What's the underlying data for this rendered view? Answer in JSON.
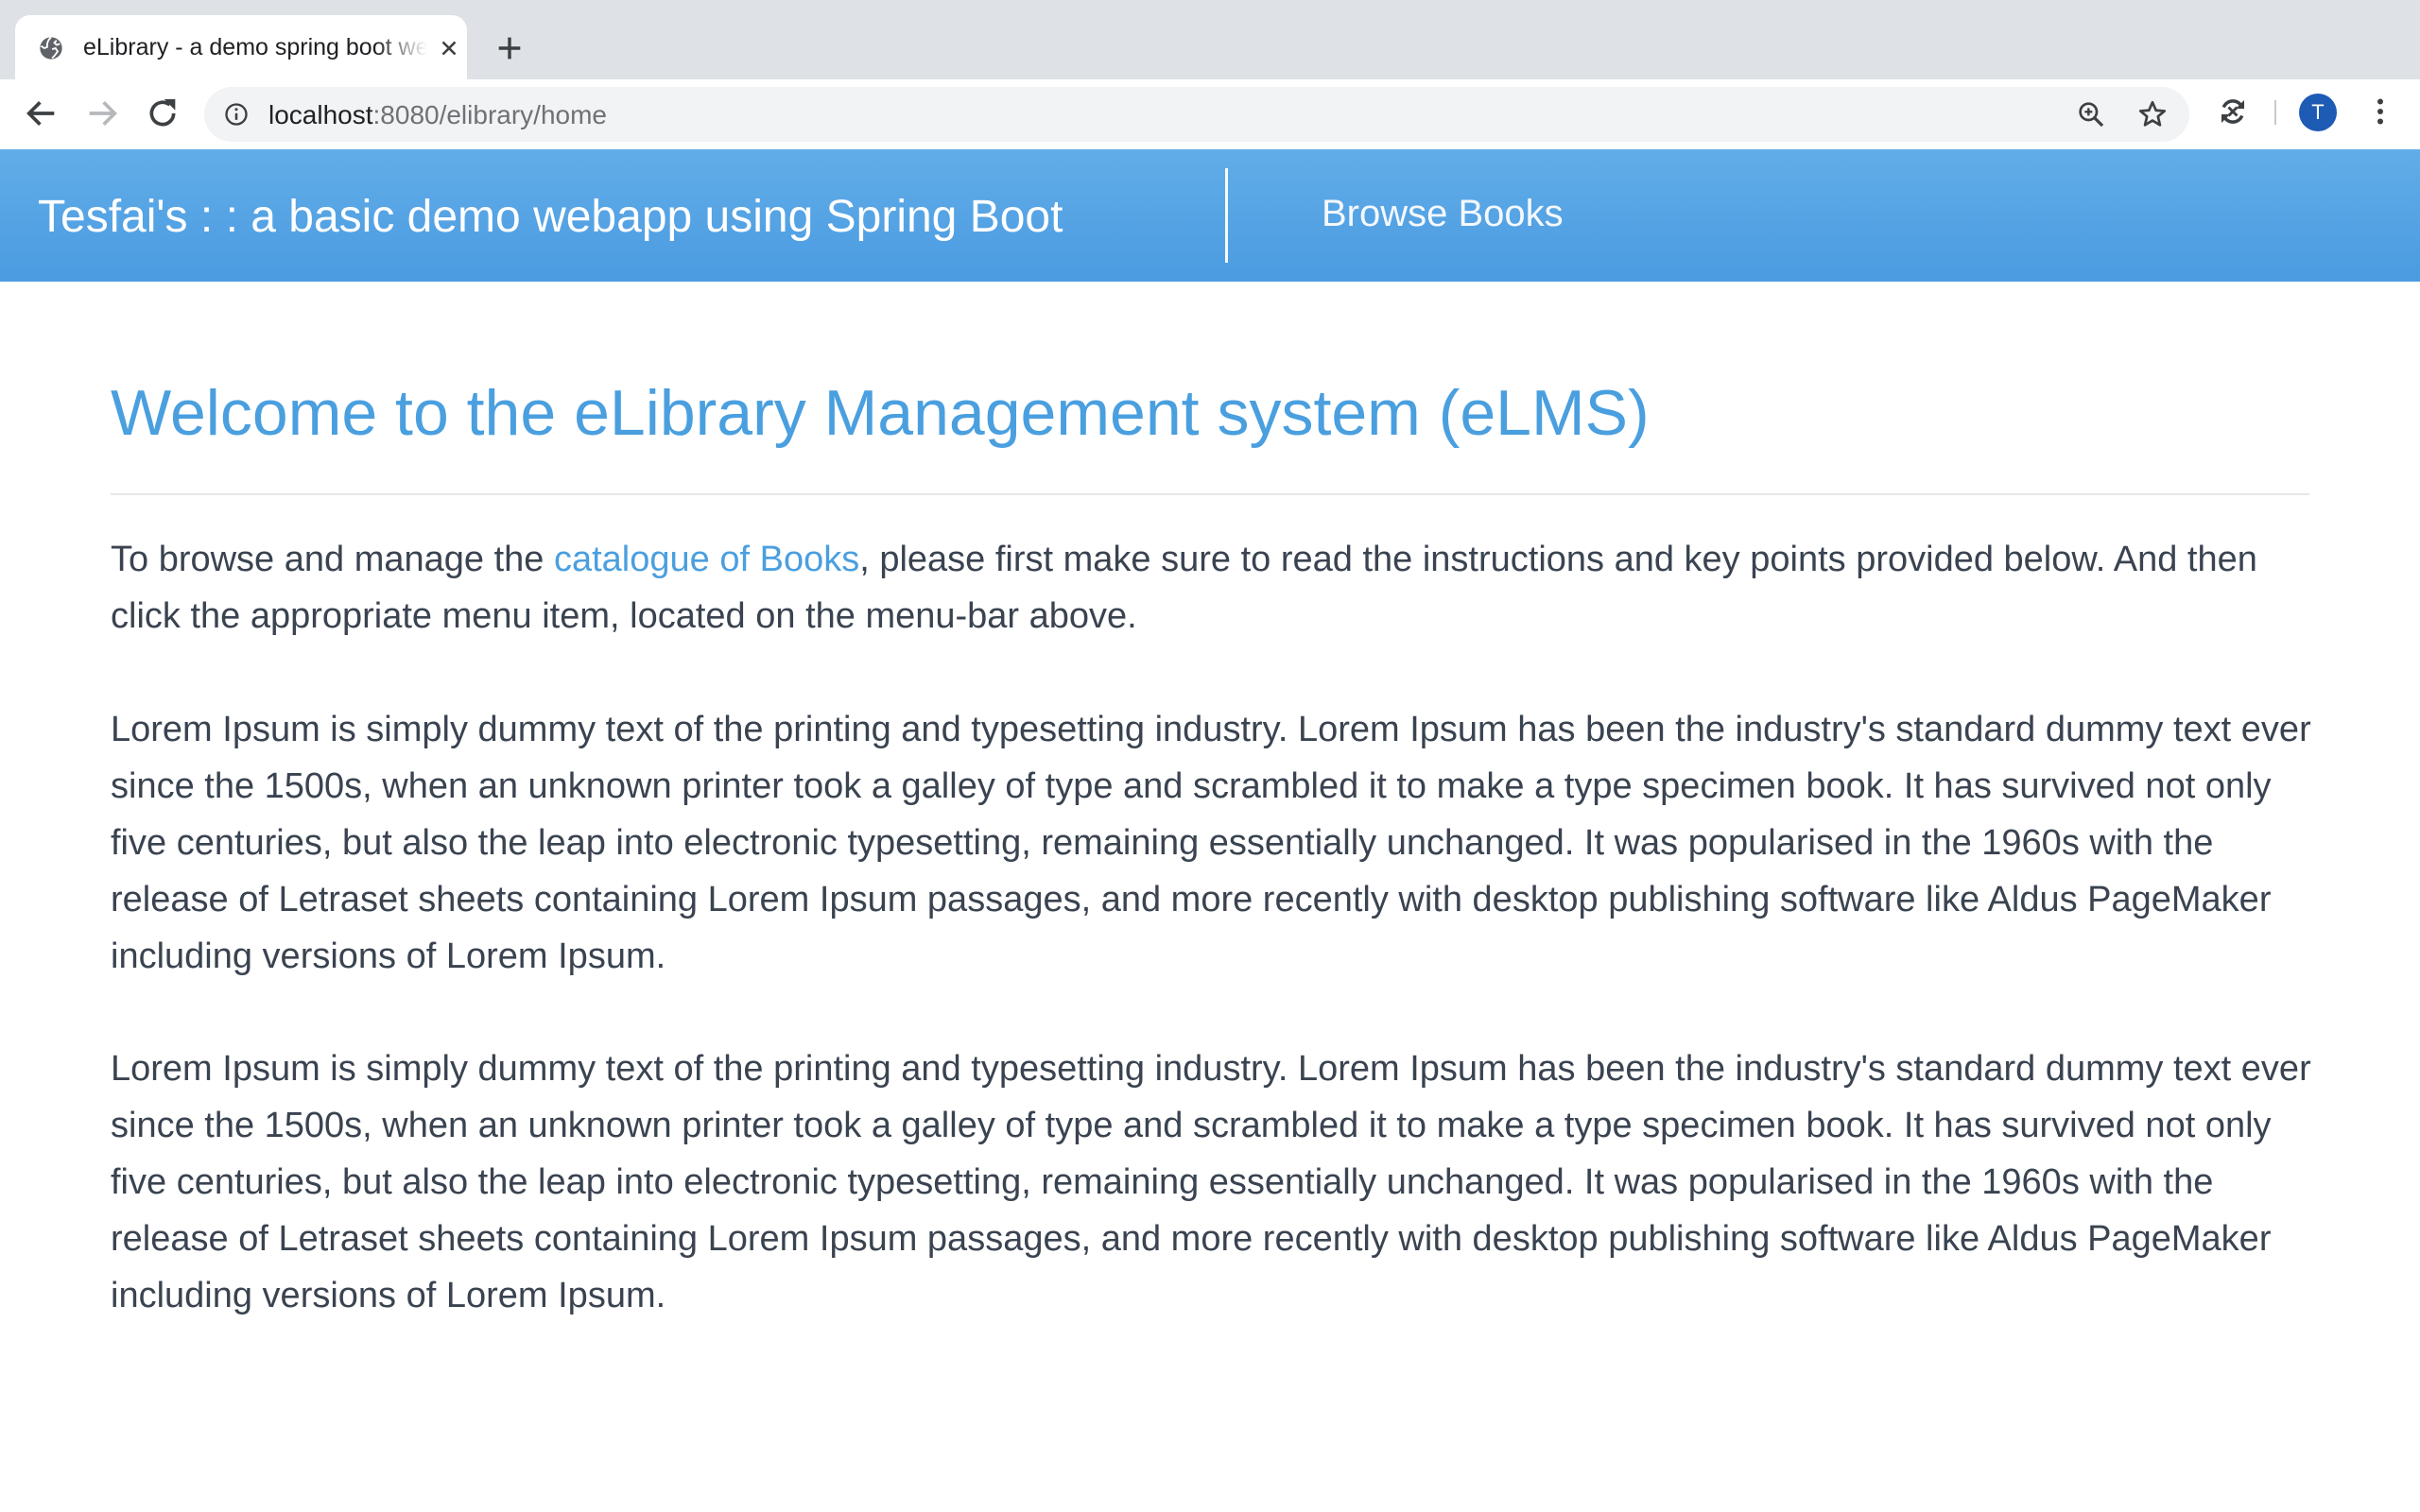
{
  "browser": {
    "tab_title": "eLibrary - a demo spring boot webapp",
    "url_host": "localhost",
    "url_path": ":8080/elibrary/home",
    "profile_initial": "T"
  },
  "header": {
    "brand": "Tesfai's : : a basic demo webapp using Spring Boot",
    "nav_browse": "Browse Books"
  },
  "main": {
    "title": "Welcome to the eLibrary Management system (eLMS)",
    "intro_before": "To browse and manage the ",
    "intro_link": "catalogue of Books",
    "intro_after": ", please first make sure to read the instructions and key points provided below. And then click the appropriate menu item, located on the menu-bar above.",
    "paragraphs": [
      "Lorem Ipsum is simply dummy text of the printing and typesetting industry. Lorem Ipsum has been the industry's standard dummy text ever since the 1500s, when an unknown printer took a galley of type and scrambled it to make a type specimen book. It has survived not only five centuries, but also the leap into electronic typesetting, remaining essentially unchanged. It was popularised in the 1960s with the release of Letraset sheets containing Lorem Ipsum passages, and more recently with desktop publishing software like Aldus PageMaker including versions of Lorem Ipsum.",
      "Lorem Ipsum is simply dummy text of the printing and typesetting industry. Lorem Ipsum has been the industry's standard dummy text ever since the 1500s, when an unknown printer took a galley of type and scrambled it to make a type specimen book. It has survived not only five centuries, but also the leap into electronic typesetting, remaining essentially unchanged. It was popularised in the 1960s with the release of Letraset sheets containing Lorem Ipsum passages, and more recently with desktop publishing software like Aldus PageMaker including versions of Lorem Ipsum."
    ]
  },
  "colors": {
    "header_top": "#62ade8",
    "header_bottom": "#4a9be1",
    "accent": "#4a9fdf",
    "body_text": "#3a4350",
    "avatar": "#1e5bb4"
  },
  "icons": [
    "globe-icon",
    "close-icon",
    "plus-icon",
    "back-arrow-icon",
    "forward-arrow-icon",
    "reload-icon",
    "info-icon",
    "zoom-icon",
    "star-icon",
    "sync-icon",
    "more-vert-icon"
  ]
}
